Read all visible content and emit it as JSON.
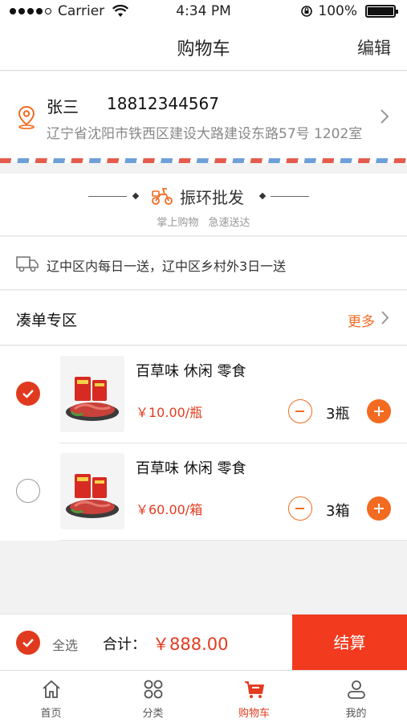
{
  "status_bar": {
    "carrier": "Carrier",
    "time": "4:34 PM",
    "battery": "100%"
  },
  "nav": {
    "title": "购物车",
    "edit": "编辑"
  },
  "address": {
    "name": "张三",
    "phone": "18812344567",
    "detail": "辽宁省沈阳市铁西区建设大路建设东路57号 1202室"
  },
  "brand": {
    "name": "振环批发",
    "slogan": "掌上购物 急速送达"
  },
  "delivery": {
    "text": "辽中区内每日一送，辽中区乡村外3日一送"
  },
  "section": {
    "title": "凑单专区",
    "more": "更多"
  },
  "items": [
    {
      "title": "百草味 休闲 零食",
      "price": "￥10.00/瓶",
      "qty": "3瓶",
      "checked": true
    },
    {
      "title": "百草味 休闲 零食",
      "price": "￥60.00/箱",
      "qty": "3箱",
      "checked": false
    }
  ],
  "checkout": {
    "select_all": "全选",
    "total_label": "合计：",
    "total": "￥888.00",
    "button": "结算"
  },
  "tabs": [
    {
      "label": "首页",
      "icon": "home-icon"
    },
    {
      "label": "分类",
      "icon": "category-icon"
    },
    {
      "label": "购物车",
      "icon": "cart-icon",
      "active": true
    },
    {
      "label": "我的",
      "icon": "user-icon"
    }
  ],
  "colors": {
    "accent": "#f26b21",
    "primary_red": "#e23b1f",
    "checkout_red": "#f23a1e"
  }
}
